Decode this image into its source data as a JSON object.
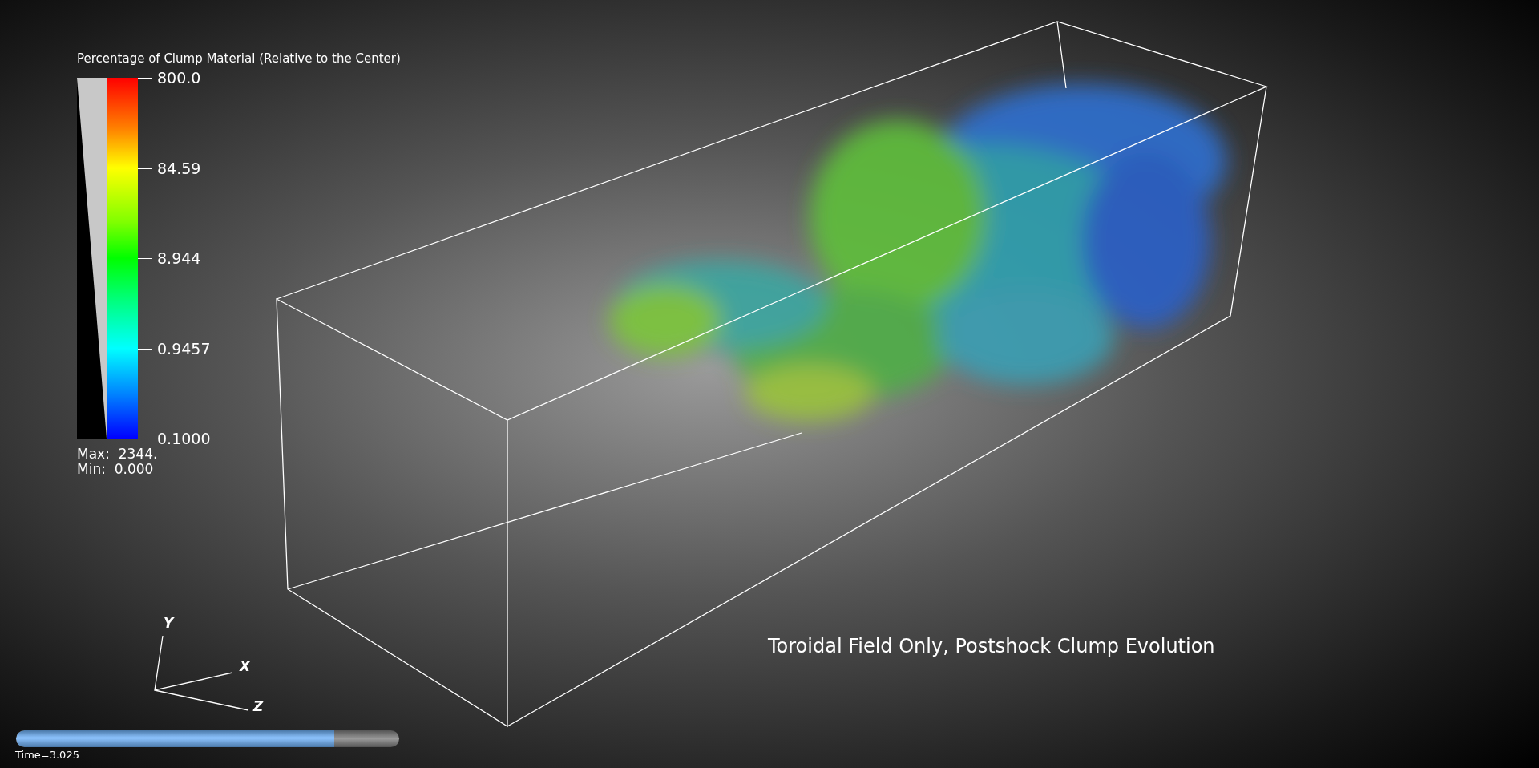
{
  "legend": {
    "title": "Percentage of Clump Material (Relative to the Center)",
    "ticks": [
      "800.0",
      "84.59",
      "8.944",
      "0.9457",
      "0.1000"
    ],
    "max": "Max:  2344.",
    "min": "Min:  0.000"
  },
  "axes": {
    "y": "Y",
    "x": "X",
    "z": "Z"
  },
  "plot_title": "Toroidal Field Only, Postshock Clump Evolution",
  "time_slider": {
    "level": 0.83,
    "label": "Time=3.025"
  }
}
